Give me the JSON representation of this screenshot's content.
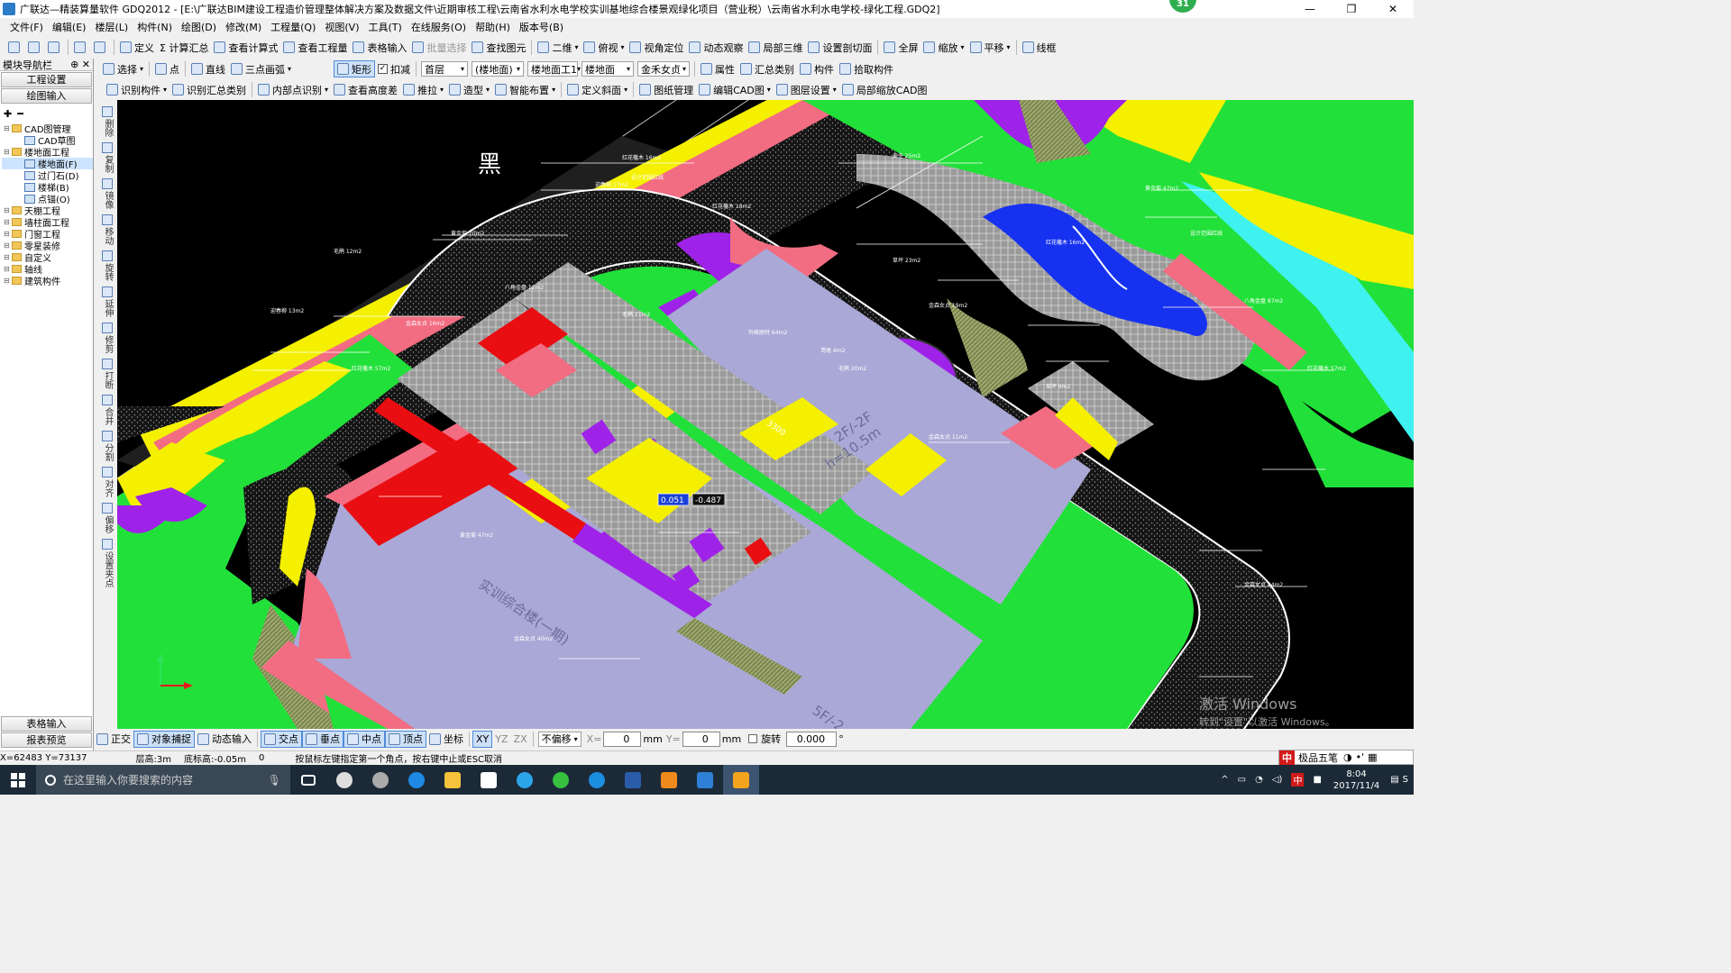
{
  "window": {
    "title": "广联达—精装算量软件 GDQ2012 - [E:\\广联达BIM建设工程造价管理整体解决方案及数据文件\\近期审核工程\\云南省水利水电学校实训基地综合楼景观绿化项目（营业税）\\云南省水利水电学校-绿化工程.GDQ2]",
    "badge": "31",
    "minimize": "—",
    "restore": "❐",
    "close": "✕"
  },
  "menu": [
    "文件(F)",
    "编辑(E)",
    "楼层(L)",
    "构件(N)",
    "绘图(D)",
    "修改(M)",
    "工程量(Q)",
    "视图(V)",
    "工具(T)",
    "在线服务(O)",
    "帮助(H)",
    "版本号(B)"
  ],
  "toolbar1": [
    "定义",
    "Σ 计算汇总",
    "查看计算式",
    "查看工程量",
    "表格输入",
    "批量选择",
    "查找图元",
    "二维",
    "俯视",
    "视角定位",
    "动态观察",
    "局部三维",
    "设置剖切面",
    "全屏",
    "缩放",
    "平移",
    "线框"
  ],
  "toolbar2": {
    "select": "选择",
    "point": "点",
    "line": "直线",
    "arc": "三点画弧",
    "rect": "矩形",
    "deduct": "扣减",
    "floor": "首层",
    "floor_type": "(楼地面)",
    "component": "楼地面工1",
    "category": "楼地面",
    "plant": "金禾女贞",
    "props": "属性",
    "summary": "汇总类别",
    "member": "构件",
    "pick": "拾取构件"
  },
  "toolbar3": [
    "识别构件",
    "识别汇总类别",
    "内部点识别",
    "查看高度差",
    "推拉",
    "造型",
    "智能布置",
    "定义斜面",
    "图纸管理",
    "编辑CAD图",
    "图层设置",
    "局部缩放CAD图"
  ],
  "left_panel": {
    "header": "模块导航栏",
    "pin": "⊕",
    "close": "✕",
    "btn_project": "工程设置",
    "btn_draw": "绘图输入",
    "tree": [
      {
        "label": "CAD图管理",
        "level": 0,
        "type": "folder"
      },
      {
        "label": "CAD草图",
        "level": 1,
        "type": "leaf"
      },
      {
        "label": "楼地面工程",
        "level": 0,
        "type": "folder"
      },
      {
        "label": "楼地面(F)",
        "level": 1,
        "type": "leaf",
        "selected": true
      },
      {
        "label": "过门石(D)",
        "level": 1,
        "type": "leaf"
      },
      {
        "label": "楼梯(B)",
        "level": 1,
        "type": "leaf"
      },
      {
        "label": "点锚(O)",
        "level": 1,
        "type": "leaf"
      },
      {
        "label": "天棚工程",
        "level": 0,
        "type": "folder"
      },
      {
        "label": "墙柱面工程",
        "level": 0,
        "type": "folder"
      },
      {
        "label": "门窗工程",
        "level": 0,
        "type": "folder"
      },
      {
        "label": "零星装修",
        "level": 0,
        "type": "folder"
      },
      {
        "label": "自定义",
        "level": 0,
        "type": "folder"
      },
      {
        "label": "轴线",
        "level": 0,
        "type": "folder"
      },
      {
        "label": "建筑构件",
        "level": 0,
        "type": "folder"
      }
    ],
    "btn_table": "表格输入",
    "btn_report": "报表预览"
  },
  "vertical_tools": [
    "删除",
    "复制",
    "镜像",
    "移动",
    "旋转",
    "延伸",
    "修剪",
    "打断",
    "合并",
    "分割",
    "对齐",
    "偏移",
    "设置夹点"
  ],
  "canvas": {
    "label_black": "黑",
    "label_2f": "2F/-2F",
    "label_h": "h=10.5m",
    "label_building": "实训综合楼(一期)",
    "label_5f": "5F/-2",
    "label_3300": "3300",
    "coord_x": "0.051",
    "coord_y": "-0.487",
    "watermark1": "激活 Windows",
    "watermark2": "转到\"设置\"以激活 Windows。",
    "plant_labels": [
      "红花檵木 16m2",
      "迎春柳 17m2",
      "设计范围红线",
      "红花檵木 18m2",
      "黄金菊 20m2",
      "毛鹃 12m2",
      "迎春柳 13m2",
      "红花檵木 57m2",
      "金森女贞 16m2",
      "麦冬 25m2",
      "草坪 23m2",
      "金森女贞 19m2",
      "黄金菊 47m2",
      "八角金盘 87m2",
      "红花檵木 57m2",
      "金森女贞 11m2",
      "毛鹃 21m2",
      "黄金菊 47m2",
      "金森女贞 40m2",
      "鸢尾 4m2",
      "红花檵木 16m2",
      "设计范围红线",
      "八角金盘 12m2",
      "玛格丽特 64m2",
      "毛鹃 20m2",
      "金森女贞 24m2",
      "草坪 9m2"
    ]
  },
  "status1": {
    "ortho": "正交",
    "snap": "对象捕捉",
    "dyn": "动态输入",
    "intersect": "交点",
    "perp": "垂点",
    "mid": "中点",
    "vertex": "顶点",
    "coord": "坐标",
    "xy": "XY",
    "yz": "YZ",
    "zx": "ZX",
    "offset": "不偏移",
    "x_label": "X=",
    "x_val": "0",
    "mm1": "mm",
    "y_label": "Y=",
    "y_val": "0",
    "mm2": "mm",
    "rotate": "旋转",
    "rot_val": "0.000",
    "deg": "°"
  },
  "status2": {
    "coords": "X=62483 Y=73137",
    "floor_h": "层高:3m",
    "base_h": "底标高:-0.05m",
    "zero": "0",
    "hint": "按鼠标左键指定第一个角点，按右键中止或ESC取消"
  },
  "ime": {
    "label": "极品五笔"
  },
  "taskbar": {
    "search_placeholder": "在这里输入你要搜索的内容",
    "time": "8:04",
    "date": "2017/11/4",
    "ime_tray": "中",
    "s": "S"
  }
}
